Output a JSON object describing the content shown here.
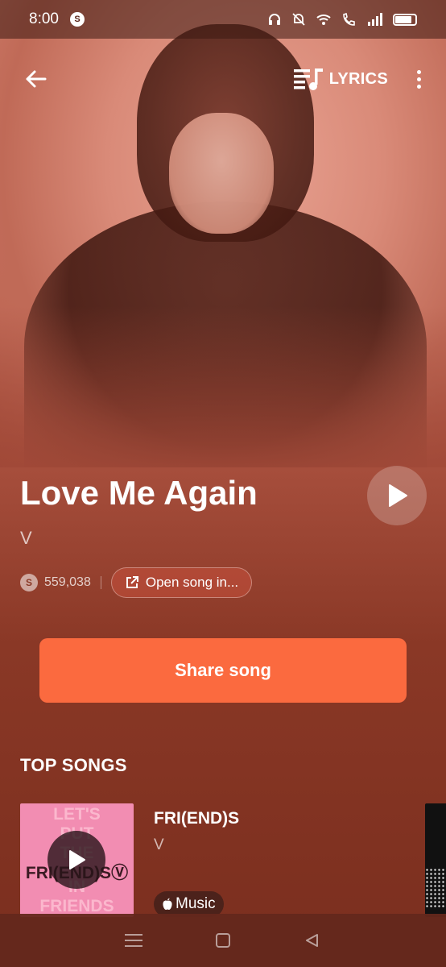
{
  "status_bar": {
    "time": "8:00",
    "app_icon": "shazam-icon",
    "icons": [
      "headphones-icon",
      "mute-bell-icon",
      "wifi-icon",
      "wifi-call-icon",
      "signal-icon",
      "battery-icon"
    ]
  },
  "toolbar": {
    "back_icon": "arrow-left-icon",
    "lyrics_label": "LYRICS",
    "lyrics_icon": "lyrics-icon",
    "menu_icon": "more-vertical-icon"
  },
  "song": {
    "title": "Love Me Again",
    "artist": "V",
    "shazam_count": "559,038",
    "open_label": "Open song in..."
  },
  "share": {
    "label": "Share song"
  },
  "top_songs": {
    "heading": "TOP SONGS",
    "items": [
      {
        "title": "FRI(END)S",
        "artist": "V",
        "art_top_lines": [
          "LET'S",
          "PUT",
          "THE"
        ],
        "art_mid": "FRI(END)SⓋ",
        "art_bottom_lines": [
          "IN",
          "FRIENDS"
        ],
        "badge": "Music"
      }
    ]
  },
  "colors": {
    "accent": "#fb6a3f",
    "background_top": "#d98a7a",
    "background_bottom": "#7a2e1e"
  },
  "nav_bar": {
    "icons": [
      "menu-icon",
      "home-square-icon",
      "back-triangle-icon"
    ]
  }
}
